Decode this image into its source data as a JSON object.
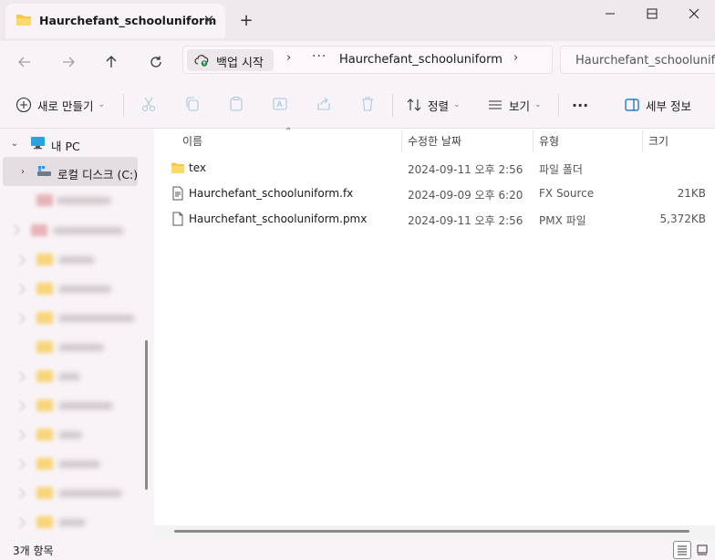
{
  "window": {
    "tab_title": "Haurchefant_schooluniform",
    "close_tab": "✕",
    "new_tab": "+"
  },
  "address": {
    "home_label": "백업 시작",
    "more": "···",
    "current_folder": "Haurchefant_schooluniform",
    "search_placeholder": "Haurchefant_schoolunifo"
  },
  "toolbar": {
    "new_label": "새로 만들기",
    "sort_label": "정렬",
    "view_label": "보기",
    "more": "···",
    "details_label": "세부 정보"
  },
  "sidebar": {
    "this_pc": "내 PC",
    "local_disk": "로컬 디스크 (C:)"
  },
  "columns": {
    "name": "이름",
    "modified": "수정한 날짜",
    "type": "유형",
    "size": "크기"
  },
  "files": [
    {
      "name": "tex",
      "modified": "2024-09-11 오후 2:56",
      "type": "파일 폴더",
      "size": "",
      "icon": "folder-icon"
    },
    {
      "name": "Haurchefant_schooluniform.fx",
      "modified": "2024-09-09 오후 6:20",
      "type": "FX Source",
      "size": "21KB",
      "icon": "code-file-icon"
    },
    {
      "name": "Haurchefant_schooluniform.pmx",
      "modified": "2024-09-11 오후 2:56",
      "type": "PMX 파일",
      "size": "5,372KB",
      "icon": "file-icon"
    }
  ],
  "status": {
    "item_count": "3개 항목"
  },
  "colors": {
    "accent": "#0067c0",
    "folder": "#f5c84c",
    "chrome": "#f8f3f6",
    "titlebar": "#efe8ec"
  }
}
